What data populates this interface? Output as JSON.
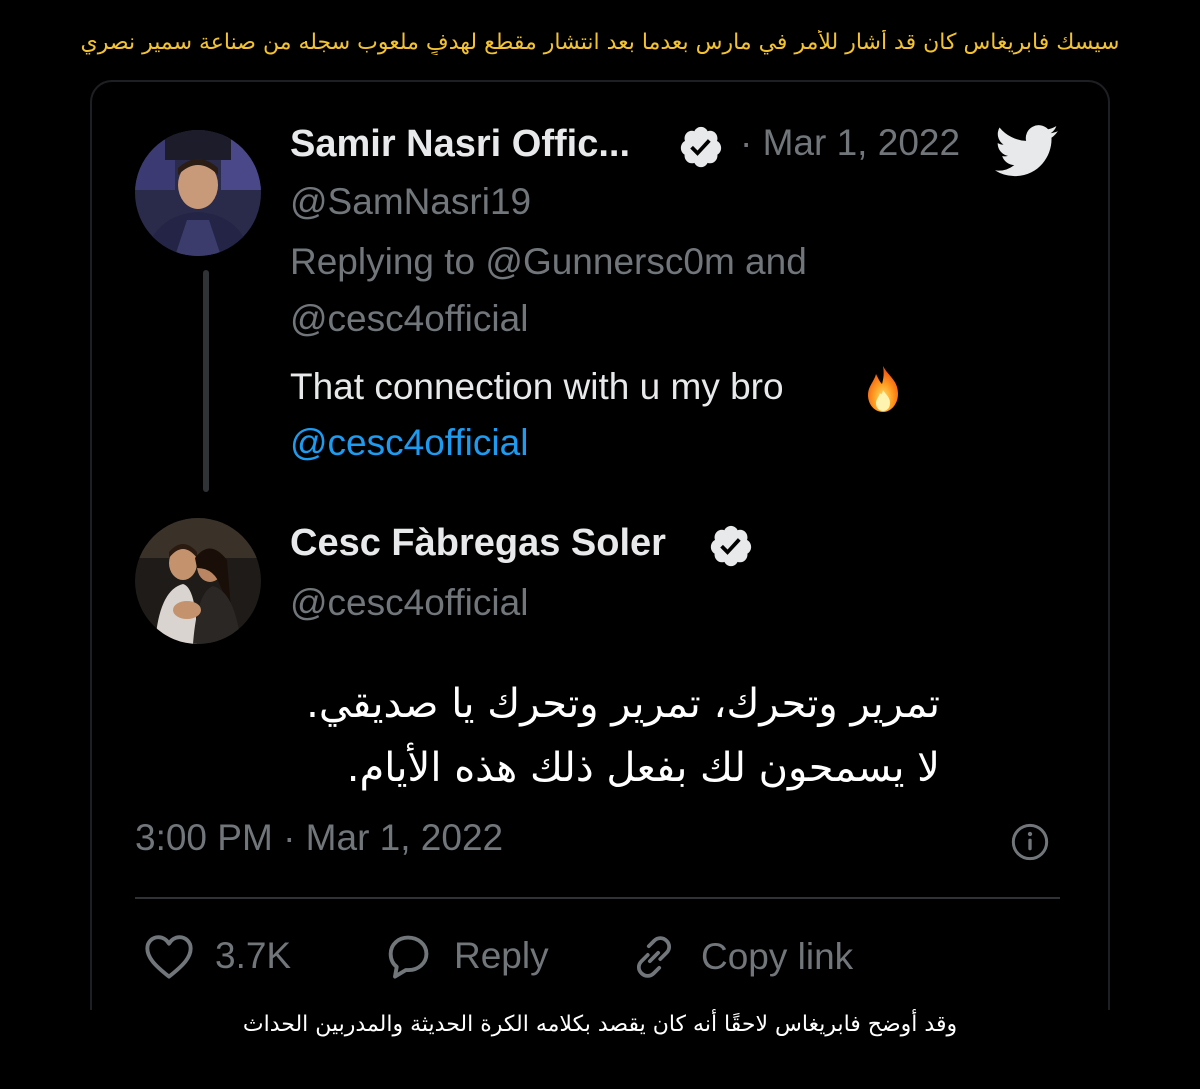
{
  "captions": {
    "top": "سيسك فابريغاس كان قد أشار للأمر في مارس بعدما بعد انتشار مقطع لهدفٍ ملعوب سجله من صناعة سمير نصري",
    "bottom": "وقد أوضح فابريغاس لاحقًا أنه كان يقصد بكلامه الكرة الحديثة والمدربين الحداث"
  },
  "reply_tweet": {
    "display_name": "Samir Nasri Offic...",
    "date": "· Mar 1, 2022",
    "handle": "@SamNasri19",
    "replying_line1": "Replying to @Gunnersc0m and",
    "replying_line2": "@cesc4official",
    "text": "That connection with u my bro",
    "mention": "@cesc4official"
  },
  "main_tweet": {
    "display_name": "Cesc Fàbregas Soler",
    "handle": "@cesc4official",
    "text_line1": "تمرير وتحرك، تمرير وتحرك يا صديقي.",
    "text_line2": "لا يسمحون لك بفعل ذلك هذه الأيام.",
    "timestamp": "3:00 PM · Mar 1, 2022"
  },
  "actions": {
    "likes": "3.7K",
    "reply": "Reply",
    "copy_link": "Copy link"
  },
  "icons": {
    "verified": "verified-badge-icon",
    "twitter": "twitter-bird-icon",
    "fire": "fire-emoji-icon",
    "info": "info-icon",
    "heart": "heart-icon",
    "reply": "reply-bubble-icon",
    "link": "link-icon"
  },
  "colors": {
    "background": "#000000",
    "primary_text": "#e7e9ea",
    "secondary_text": "#71767b",
    "link": "#1d9bf0",
    "caption_top": "#f2c230",
    "caption_bottom": "#ffffff"
  }
}
